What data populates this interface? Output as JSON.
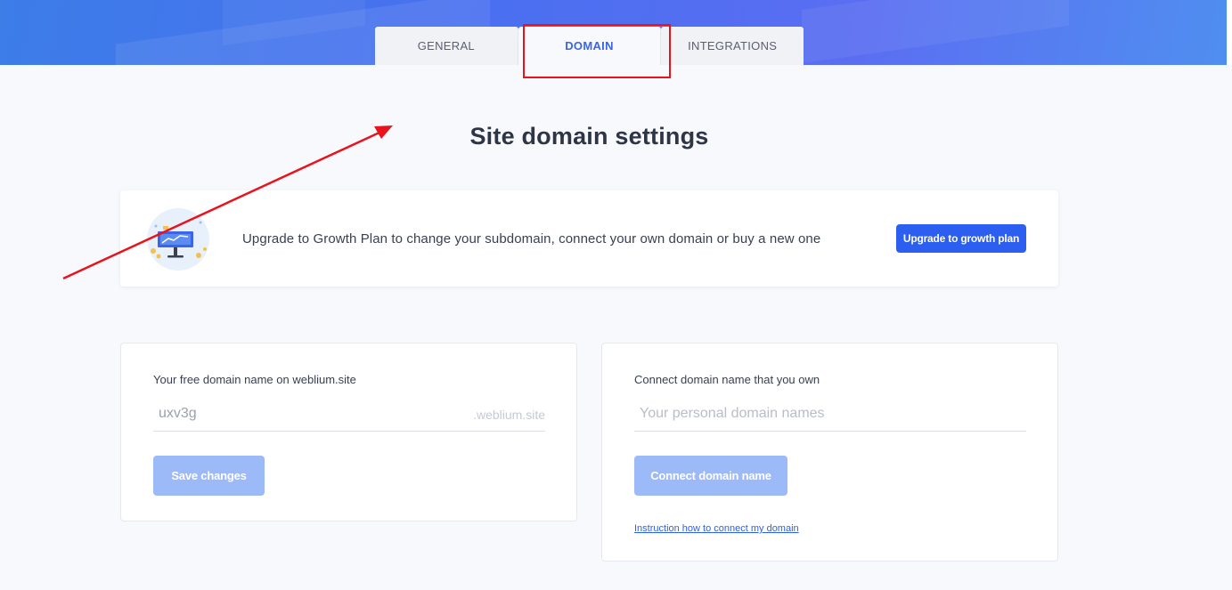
{
  "tabs": [
    {
      "label": "GENERAL",
      "active": false
    },
    {
      "label": "DOMAIN",
      "active": true
    },
    {
      "label": "INTEGRATIONS",
      "active": false
    }
  ],
  "page_title": "Site domain settings",
  "upgrade": {
    "text": "Upgrade to Growth Plan to change your subdomain, connect your own domain or buy a new one",
    "button_label": "Upgrade to growth plan"
  },
  "free_domain": {
    "label": "Your free domain name on weblium.site",
    "input_value": "uxv3g",
    "suffix": ".weblium.site",
    "save_label": "Save changes"
  },
  "own_domain": {
    "label": "Connect domain name that you own",
    "placeholder": "Your personal domain names",
    "connect_label": "Connect domain name",
    "instruction_link": "Instruction how to connect my domain"
  },
  "colors": {
    "accent": "#2c5ff0",
    "disabled_button": "#9dbaf8",
    "annotation_red": "#e8131d"
  }
}
